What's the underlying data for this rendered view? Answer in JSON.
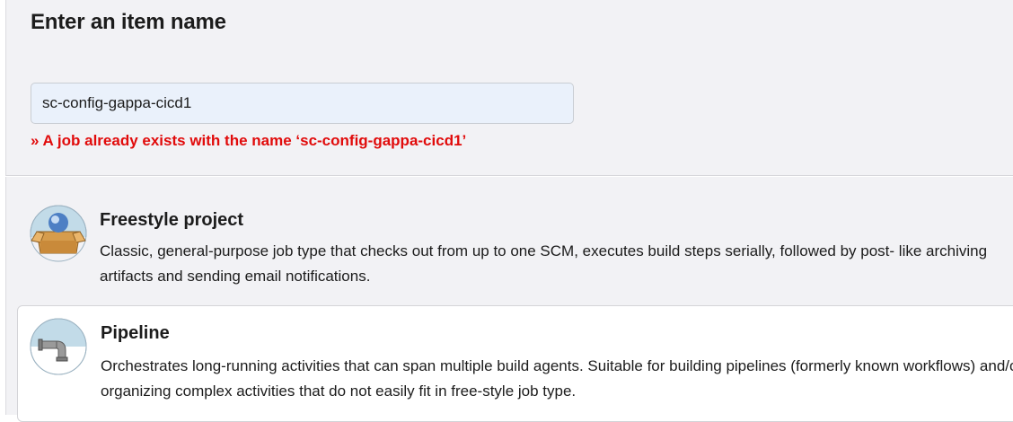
{
  "form": {
    "title": "Enter an item name",
    "item_name_value": "sc-config-gappa-cicd1",
    "error_message": "» A job already exists with the name ‘sc-config-gappa-cicd1’"
  },
  "item_types": [
    {
      "title": "Freestyle project",
      "description": "Classic, general-purpose job type that checks out from up to one SCM, executes build steps serially, followed by post- like archiving artifacts and sending email notifications.",
      "icon": "freestyle-project-icon"
    },
    {
      "title": "Pipeline",
      "description": "Orchestrates long-running activities that can span multiple build agents. Suitable for building pipelines (formerly known workflows) and/or organizing complex activities that do not easily fit in free-style job type.",
      "icon": "pipeline-icon",
      "selected": true
    }
  ],
  "colors": {
    "panel_background": "#f2f2f5",
    "input_background": "#eaf1fb",
    "error_text": "#e10b0b",
    "selected_item_background": "#ffffff"
  }
}
